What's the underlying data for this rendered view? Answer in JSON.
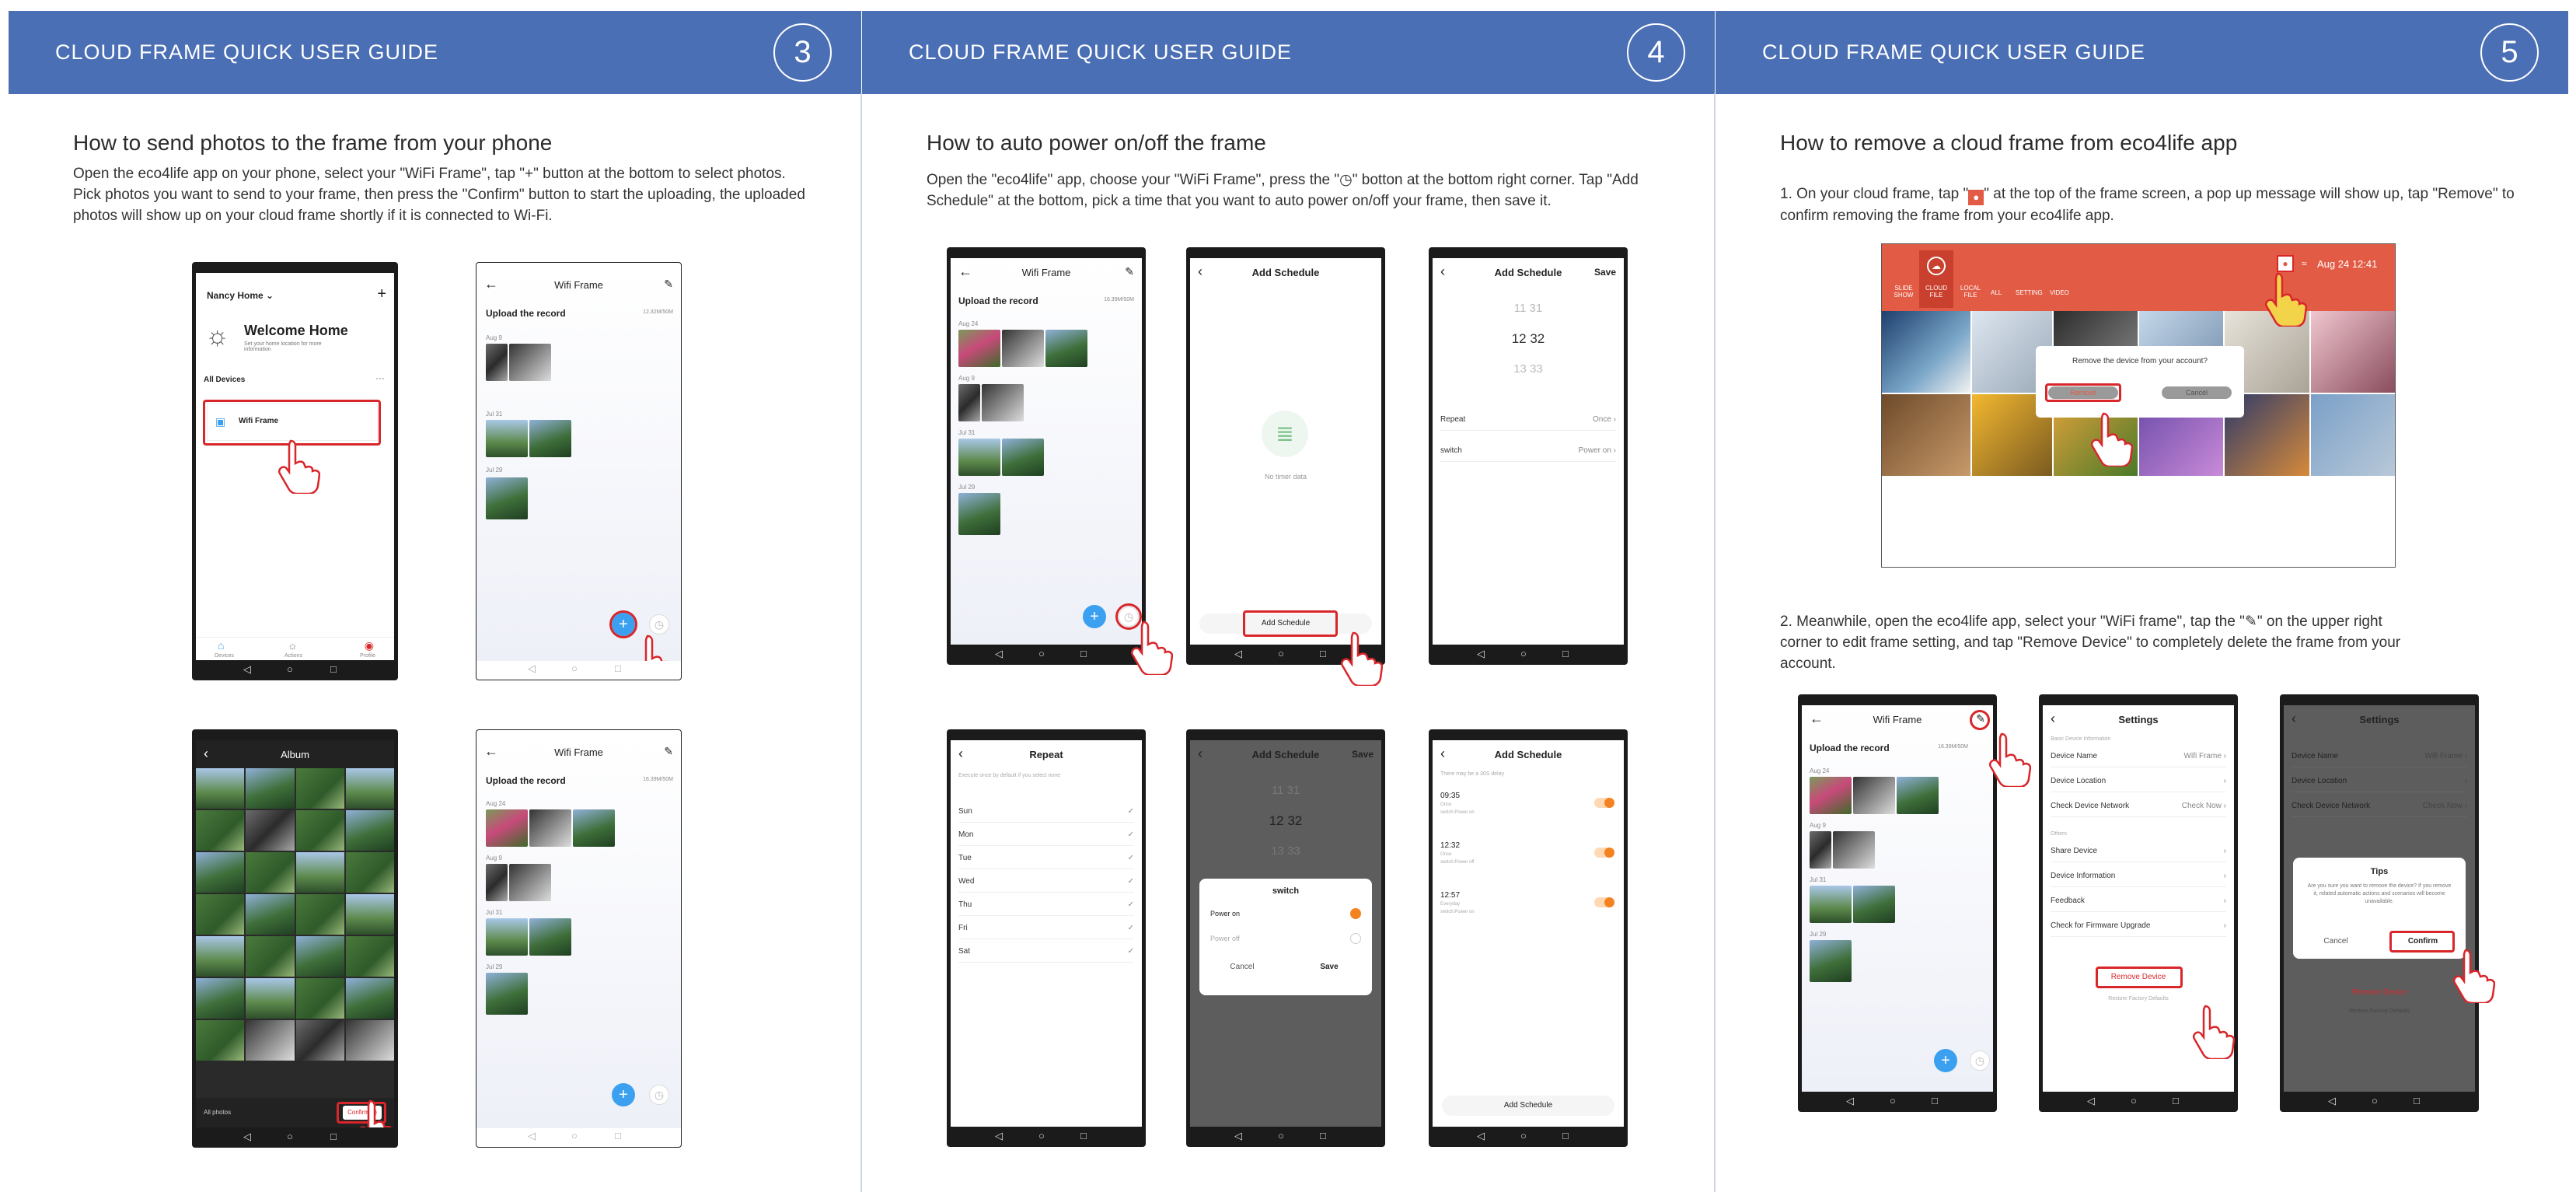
{
  "header_title": "CLOUD FRAME QUICK USER GUIDE",
  "pages": [
    {
      "number": "3",
      "heading": "How to send photos to the frame from your phone",
      "body": "Open the eco4life app on your phone, select your \"WiFi Frame\", tap \"+\" button at the bottom to select photos. Pick photos you want to send to your frame, then press the \"Confirm\" button to start the uploading, the uploaded photos will show up on your cloud frame shortly if it is connected to Wi-Fi."
    },
    {
      "number": "4",
      "heading": "How to auto power on/off the frame",
      "body_a": "Open the \"eco4life\" app, choose your \"WiFi Frame\", press the \"",
      "body_b": "\" botton at the bottom right corner. Tap \"Add Schedule\" at the bottom, pick a time that you want to auto power on/off your frame, then save it."
    },
    {
      "number": "5",
      "heading": "How to remove a cloud frame from eco4life app",
      "step1_a": "1. On your cloud frame, tap \"",
      "step1_b": "\" at the top of the frame screen, a pop up message will show up, tap \"Remove\" to confirm removing the frame from your eco4life app.",
      "step2_a": "2. Meanwhile, open the eco4life app, select your \"WiFi frame\", tap the \"",
      "step2_b": "\" on the upper right corner to edit frame setting, and tap \"Remove Device\" to completely delete the frame from your account."
    }
  ],
  "app": {
    "home_title": "Nancy Home",
    "welcome": "Welcome Home",
    "welcome_sub": "Set your home location for more information",
    "all_devices": "All Devices",
    "wifi_frame": "Wifi Frame",
    "upload_record": "Upload the record",
    "storage": "12.32M/50M",
    "storage2": "16.39M/50M",
    "dates1": [
      "Aug 9",
      "Jul 31",
      "Jul 29"
    ],
    "dates2": [
      "Aug 24",
      "Aug 9",
      "Jul 31",
      "Jul 29"
    ],
    "album": "Album",
    "all_photos": "All photos",
    "confirm_count": "Confirm(3)",
    "tabs": [
      "Devices",
      "Actions",
      "Profile"
    ],
    "add_schedule": "Add Schedule",
    "save": "Save",
    "no_timer": "No timer data",
    "times": [
      "11  31",
      "12  32",
      "13  33"
    ],
    "repeat": "Repeat",
    "once": "Once",
    "switch": "switch",
    "power_on": "Power on",
    "power_off": "Power off",
    "cancel": "Cancel",
    "repeat_hint": "Execute once by default if you select none",
    "days": [
      "Sun",
      "Mon",
      "Tue",
      "Wed",
      "Thu",
      "Fri",
      "Sat"
    ],
    "delay_note": "There may be a 30S delay",
    "sched": [
      {
        "time": "09:35",
        "sub": "Once",
        "sub2": "switch:Power on"
      },
      {
        "time": "12:32",
        "sub": "Once",
        "sub2": "switch:Power off"
      },
      {
        "time": "12:57",
        "sub": "Everyday",
        "sub2": "switch:Power on"
      }
    ],
    "settings": "Settings",
    "basic_info": "Basic Device Information",
    "device_name": "Device Name",
    "device_location": "Device Location",
    "check_network": "Check Device Network",
    "check_now": "Check Now",
    "others": "Others",
    "share_device": "Share Device",
    "device_info": "Device Information",
    "feedback": "Feedback",
    "firmware": "Check for Firmware Upgrade",
    "remove_device": "Remove Device",
    "restore": "Restore Factory Defaults",
    "tips": "Tips",
    "tips_msg": "Are you sure you want to remove the device? If you remove it, related automatic actions and scenarios will become unavailable.",
    "confirm": "Confirm"
  },
  "frame": {
    "tabs": [
      "SLIDE SHOW",
      "CLOUD FILE",
      "LOCAL FILE",
      "ALL",
      "SETTING",
      "VIDEO"
    ],
    "datetime": "Aug 24  12:41",
    "remove_msg": "Remove the device from your account?",
    "remove": "Remove",
    "cancel": "Cancel"
  },
  "colors": {
    "header": "#4b6fb5",
    "accent_red": "#d8262a",
    "app_blue": "#3ba0f0",
    "app_orange": "#f58220",
    "frame_red": "#e25b45"
  }
}
